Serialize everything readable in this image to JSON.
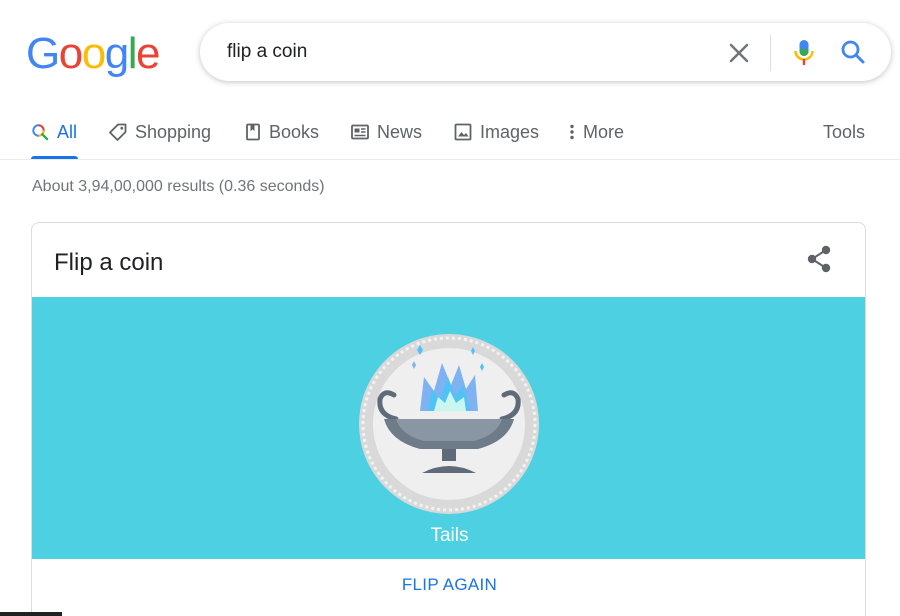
{
  "logo": {
    "letters": [
      "G",
      "o",
      "o",
      "g",
      "l",
      "e"
    ],
    "colors": [
      "#4285F4",
      "#EA4335",
      "#FBBC05",
      "#4285F4",
      "#34A853",
      "#EA4335"
    ]
  },
  "search": {
    "query": "flip a coin",
    "icons": [
      "close-icon",
      "microphone-icon",
      "search-icon"
    ]
  },
  "tabs": [
    {
      "label": "All",
      "icon": "search-icon",
      "active": true
    },
    {
      "label": "Shopping",
      "icon": "tag-icon"
    },
    {
      "label": "Books",
      "icon": "book-icon"
    },
    {
      "label": "News",
      "icon": "newspaper-icon"
    },
    {
      "label": "Images",
      "icon": "image-icon"
    },
    {
      "label": "More",
      "icon": "more-vert-icon"
    }
  ],
  "tools_label": "Tools",
  "result_stats": "About 3,94,00,000 results (0.36 seconds)",
  "card": {
    "title": "Flip a coin",
    "coin_side": "Tails",
    "flip_again": "FLIP AGAIN",
    "background_color": "#4dd0e1",
    "share_icon": "share-icon"
  },
  "colors": {
    "accent": "#1a73e8",
    "secondary_text": "#5f6368",
    "stats_text": "#70757a"
  }
}
